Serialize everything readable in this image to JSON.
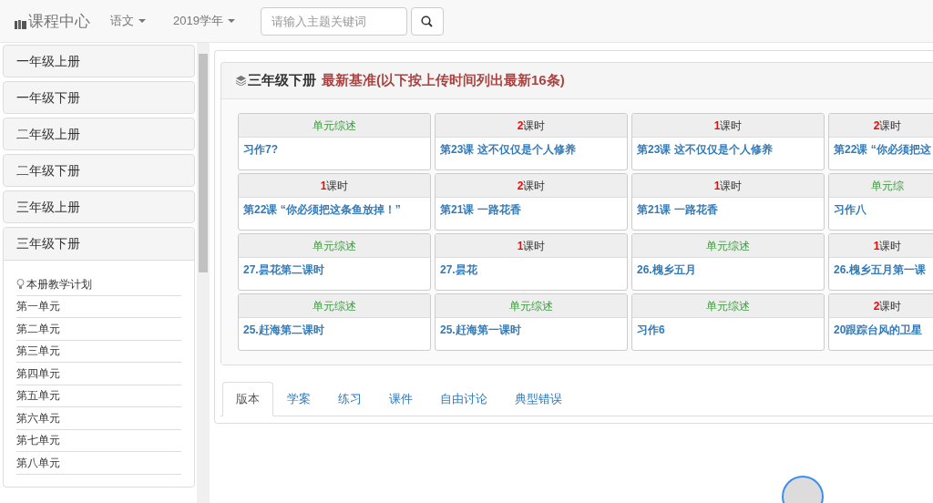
{
  "navbar": {
    "brand": "课程中心",
    "menus": [
      {
        "label": "语文"
      },
      {
        "label": "2019学年"
      }
    ],
    "search": {
      "placeholder": "请输入主题关键词"
    }
  },
  "sidebar": {
    "items": [
      {
        "label": "一年级上册",
        "expanded": false
      },
      {
        "label": "一年级下册",
        "expanded": false
      },
      {
        "label": "二年级上册",
        "expanded": false
      },
      {
        "label": "二年级下册",
        "expanded": false
      },
      {
        "label": "三年级上册",
        "expanded": false
      },
      {
        "label": "三年级下册",
        "expanded": true,
        "children": [
          {
            "label": "本册教学计划",
            "kind": "plan"
          },
          {
            "label": "第一单元",
            "kind": "unit"
          },
          {
            "label": "第二单元",
            "kind": "unit"
          },
          {
            "label": "第三单元",
            "kind": "unit"
          },
          {
            "label": "第四单元",
            "kind": "unit"
          },
          {
            "label": "第五单元",
            "kind": "unit"
          },
          {
            "label": "第六单元",
            "kind": "unit"
          },
          {
            "label": "第七单元",
            "kind": "unit"
          },
          {
            "label": "第八单元",
            "kind": "unit"
          }
        ]
      }
    ]
  },
  "panel": {
    "title": "三年级下册",
    "subtitle": "最新基准(以下按上传时间列出最新16条)",
    "cards": [
      {
        "kind": "summary",
        "label": "单元综述",
        "title": "习作7?"
      },
      {
        "kind": "lessons",
        "count": "2",
        "unit": "课时",
        "title": "第23课 这不仅仅是个人修养"
      },
      {
        "kind": "lessons",
        "count": "1",
        "unit": "课时",
        "title": "第23课 这不仅仅是个人修养"
      },
      {
        "kind": "lessons",
        "count": "2",
        "unit": "课时",
        "title": "第22课 “你必须把这"
      },
      {
        "kind": "lessons",
        "count": "1",
        "unit": "课时",
        "title": "第22课 “你必须把这条鱼放掉！”"
      },
      {
        "kind": "lessons",
        "count": "2",
        "unit": "课时",
        "title": "第21课 一路花香"
      },
      {
        "kind": "lessons",
        "count": "1",
        "unit": "课时",
        "title": "第21课 一路花香"
      },
      {
        "kind": "summary",
        "label": "单元综",
        "title": "习作八"
      },
      {
        "kind": "summary",
        "label": "单元综述",
        "title": "27.昙花第二课时"
      },
      {
        "kind": "lessons",
        "count": "1",
        "unit": "课时",
        "title": "27.昙花"
      },
      {
        "kind": "summary",
        "label": "单元综述",
        "title": "26.槐乡五月"
      },
      {
        "kind": "lessons",
        "count": "1",
        "unit": "课时",
        "title": "26.槐乡五月第一课"
      },
      {
        "kind": "summary",
        "label": "单元综述",
        "title": "25.赶海第二课时"
      },
      {
        "kind": "summary",
        "label": "单元综述",
        "title": "25.赶海第一课时"
      },
      {
        "kind": "summary",
        "label": "单元综述",
        "title": "习作6"
      },
      {
        "kind": "lessons",
        "count": "2",
        "unit": "课时",
        "title": "20跟踪台风的卫星"
      }
    ]
  },
  "tabs": [
    {
      "label": "版本",
      "selected": true
    },
    {
      "label": "学案",
      "selected": false
    },
    {
      "label": "练习",
      "selected": false
    },
    {
      "label": "课件",
      "selected": false
    },
    {
      "label": "自由讨论",
      "selected": false
    },
    {
      "label": "典型错误",
      "selected": false
    }
  ]
}
